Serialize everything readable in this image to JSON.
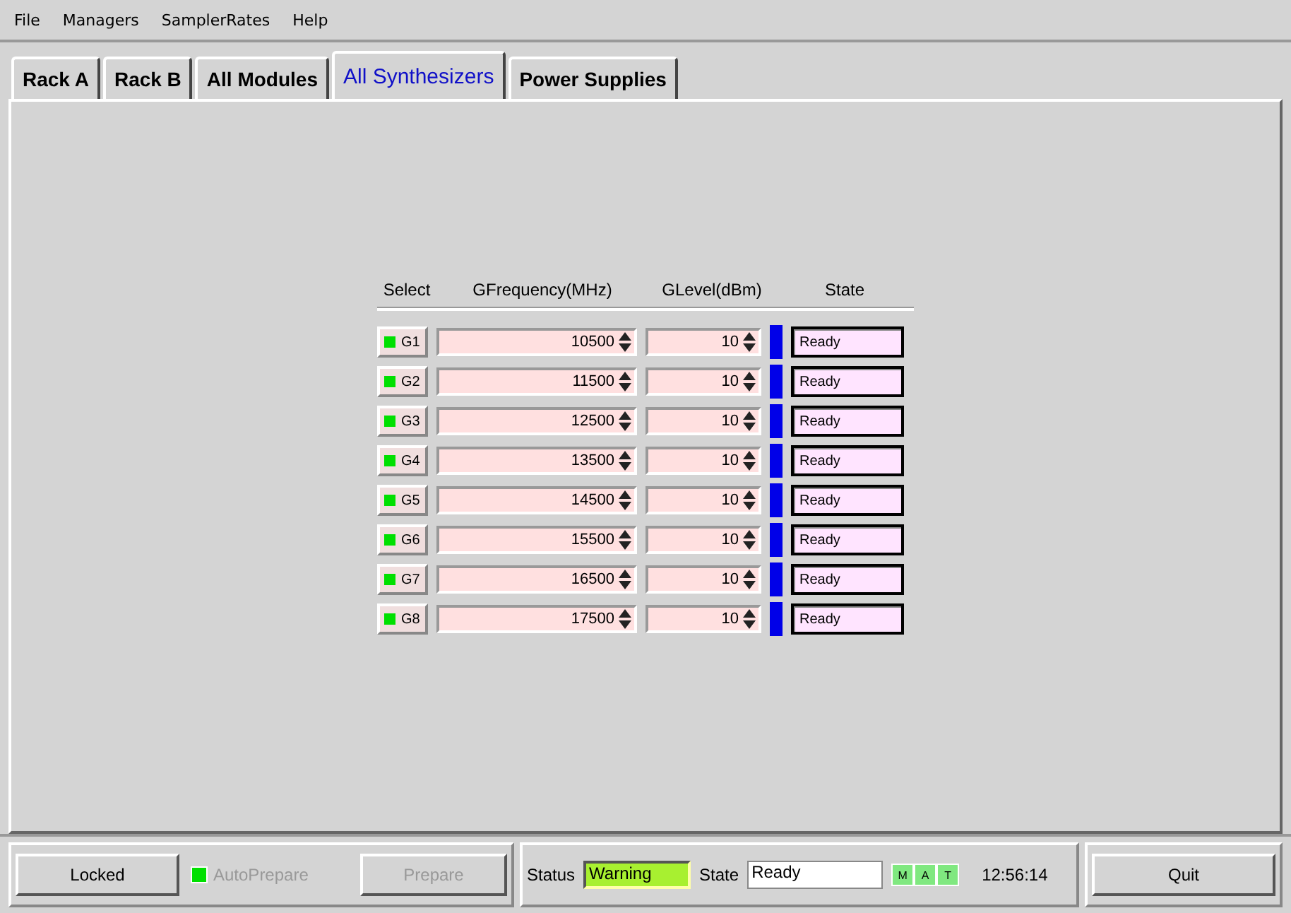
{
  "menu": [
    "File",
    "Managers",
    "SamplerRates",
    "Help"
  ],
  "tabs": [
    {
      "label": "Rack A",
      "selected": false
    },
    {
      "label": "Rack B",
      "selected": false
    },
    {
      "label": "All Modules",
      "selected": false
    },
    {
      "label": "All Synthesizers",
      "selected": true
    },
    {
      "label": "Power Supplies",
      "selected": false
    }
  ],
  "table": {
    "columns": [
      "Select",
      "GFrequency(MHz)",
      "GLevel(dBm)",
      "State"
    ],
    "rows": [
      {
        "name": "G1",
        "checked": true,
        "frequency": "10500",
        "level": "10",
        "state": "Ready"
      },
      {
        "name": "G2",
        "checked": true,
        "frequency": "11500",
        "level": "10",
        "state": "Ready"
      },
      {
        "name": "G3",
        "checked": true,
        "frequency": "12500",
        "level": "10",
        "state": "Ready"
      },
      {
        "name": "G4",
        "checked": true,
        "frequency": "13500",
        "level": "10",
        "state": "Ready"
      },
      {
        "name": "G5",
        "checked": true,
        "frequency": "14500",
        "level": "10",
        "state": "Ready"
      },
      {
        "name": "G6",
        "checked": true,
        "frequency": "15500",
        "level": "10",
        "state": "Ready"
      },
      {
        "name": "G7",
        "checked": true,
        "frequency": "16500",
        "level": "10",
        "state": "Ready"
      },
      {
        "name": "G8",
        "checked": true,
        "frequency": "17500",
        "level": "10",
        "state": "Ready"
      }
    ]
  },
  "bottom": {
    "locked_button": "Locked",
    "auto_prepare": {
      "label": "AutoPrepare",
      "checked": true,
      "disabled": true
    },
    "prepare_button": {
      "label": "Prepare",
      "disabled": true
    },
    "status_label": "Status",
    "status_value": "Warning",
    "state_label": "State",
    "state_value": "Ready",
    "indicators": [
      {
        "label": "M",
        "on": true
      },
      {
        "label": "A",
        "on": true
      },
      {
        "label": "T",
        "on": true
      }
    ],
    "time": "12:56:14",
    "quit_button": "Quit"
  }
}
